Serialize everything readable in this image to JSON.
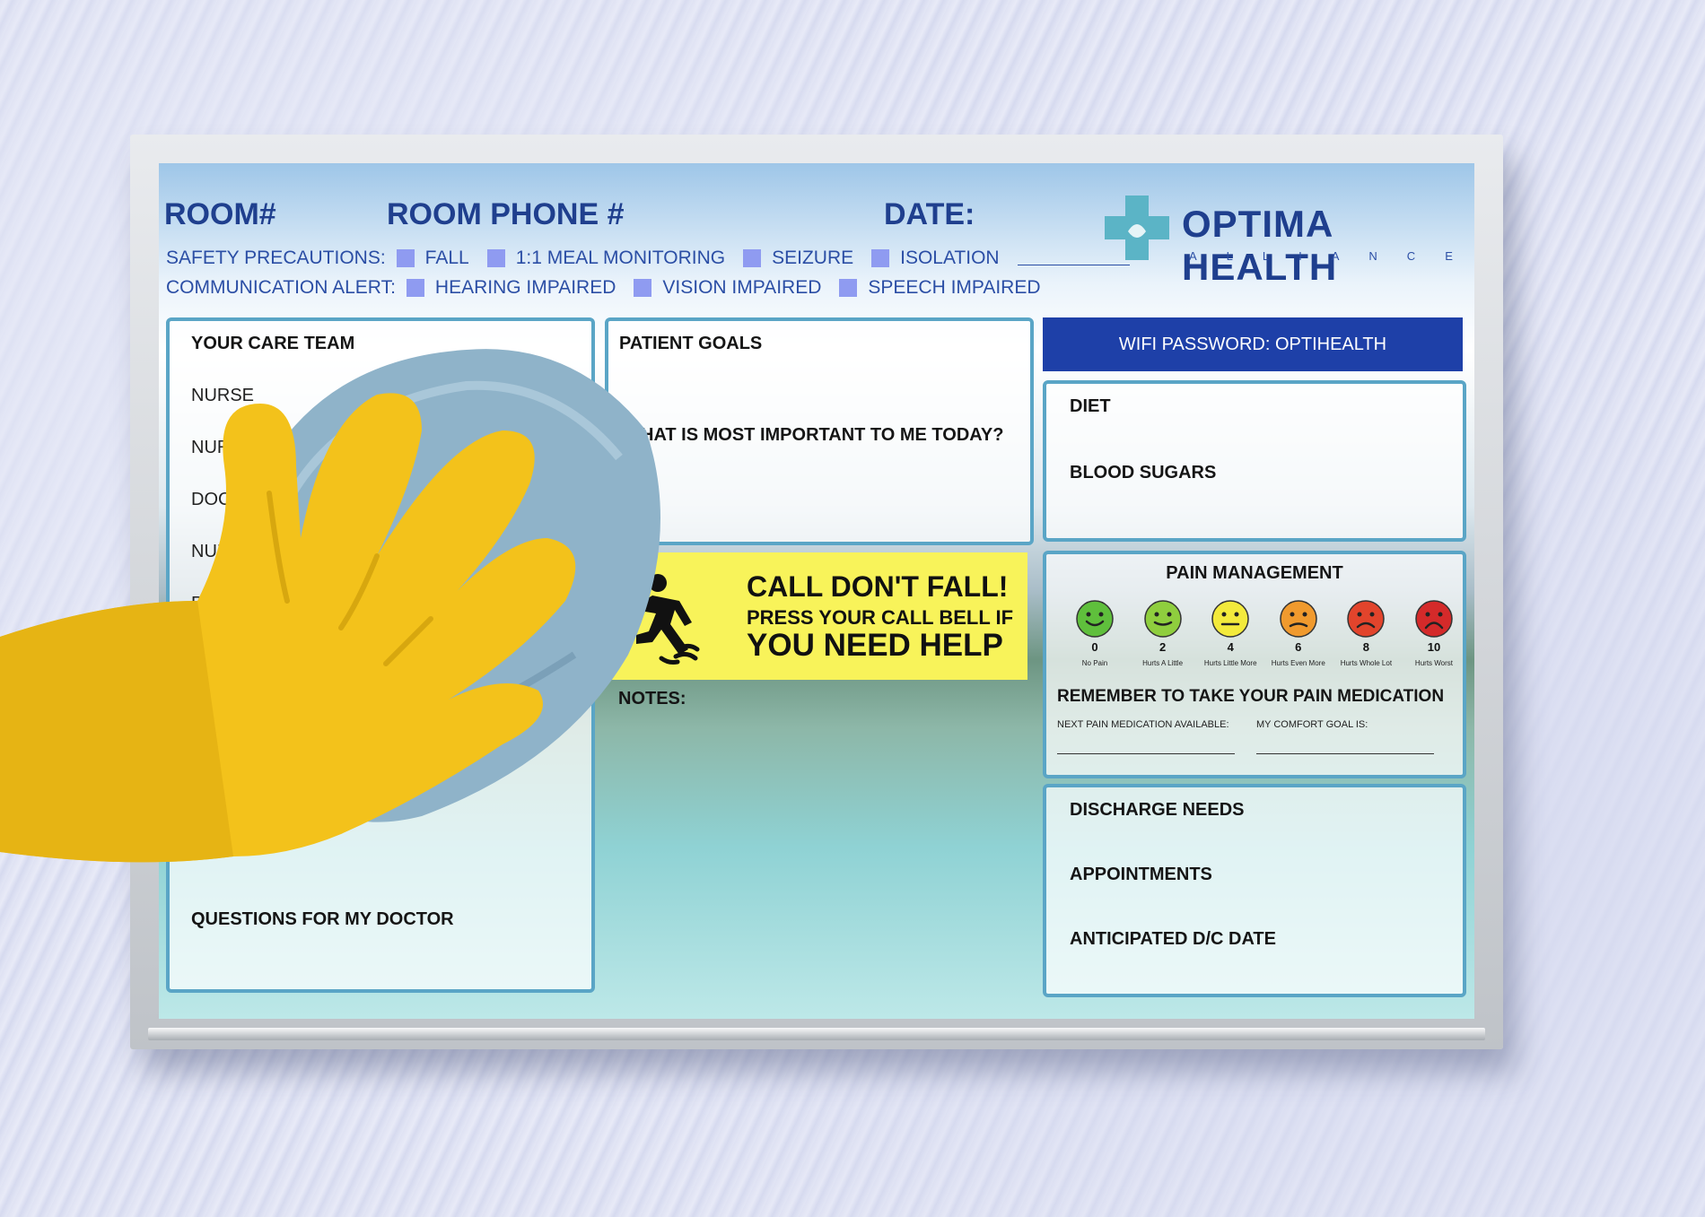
{
  "header": {
    "room": "ROOM#",
    "room_phone": "ROOM PHONE #",
    "date": "DATE:"
  },
  "safety": {
    "label": "SAFETY PRECAUTIONS:",
    "options": [
      "FALL",
      "1:1 MEAL MONITORING",
      "SEIZURE",
      "ISOLATION"
    ]
  },
  "communication": {
    "label": "COMMUNICATION ALERT:",
    "options": [
      "HEARING IMPAIRED",
      "VISION IMPAIRED",
      "SPEECH IMPAIRED"
    ]
  },
  "logo": {
    "title": "OPTIMA HEALTH",
    "subtitle": "ALLIANCE"
  },
  "care_team": {
    "title": "YOUR CARE TEAM",
    "roles": [
      "NURSE",
      "NURSE ASSIST",
      "DOCTO",
      "NURSE",
      "PH"
    ],
    "questions": "QUESTIONS FOR MY DOCTOR"
  },
  "goals": {
    "title": "PATIENT GOALS",
    "question": "HAT IS MOST IMPORTANT TO ME TODAY?"
  },
  "wifi": {
    "label": "WIFI PASSWORD: OPTIHEALTH"
  },
  "diet": {
    "title": "DIET",
    "blood_sugars": "BLOOD SUGARS"
  },
  "fall_sign": {
    "line1": "CALL DON'T FALL!",
    "line2": "PRESS YOUR CALL BELL IF",
    "line3": "YOU NEED HELP",
    "color": "#f8f35a"
  },
  "notes": {
    "title": "NOTES:"
  },
  "pain": {
    "title": "PAIN MANAGEMENT",
    "scale": [
      {
        "value": "0",
        "caption": "No Pain",
        "color": "#5fbf3c"
      },
      {
        "value": "2",
        "caption": "Hurts A Little",
        "color": "#8fce3e"
      },
      {
        "value": "4",
        "caption": "Hurts Little More",
        "color": "#f3ea3c"
      },
      {
        "value": "6",
        "caption": "Hurts Even More",
        "color": "#f09a2e"
      },
      {
        "value": "8",
        "caption": "Hurts Whole Lot",
        "color": "#e2442c"
      },
      {
        "value": "10",
        "caption": "Hurts Worst",
        "color": "#d42a2a"
      }
    ],
    "reminder": "REMEMBER TO TAKE YOUR PAIN MEDICATION",
    "next_med": "NEXT PAIN MEDICATION AVAILABLE:",
    "comfort_goal": "MY COMFORT GOAL IS:"
  },
  "discharge": {
    "needs": "DISCHARGE NEEDS",
    "appointments": "APPOINTMENTS",
    "date": "ANTICIPATED D/C DATE"
  },
  "colors": {
    "header_blue": "#1f3f8e",
    "panel_border": "#5aa5c6",
    "wifi_bg": "#1e40a8",
    "checkbox": "#8f9bf1",
    "glove": "#f3c21b",
    "cloth": "#8fb3c9"
  }
}
